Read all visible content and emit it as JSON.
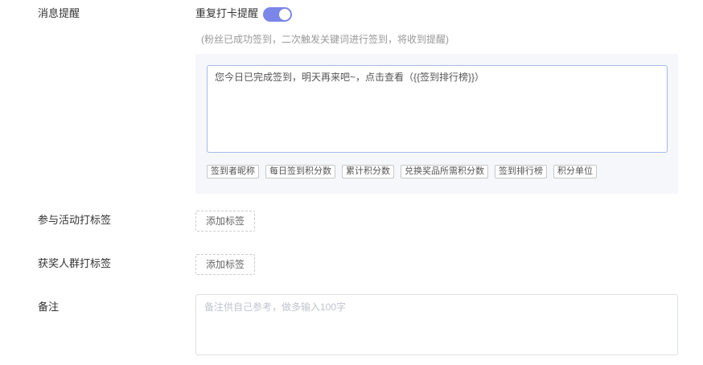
{
  "form": {
    "message_reminder": {
      "label": "消息提醒",
      "repeat_reminder_label": "重复打卡提醒",
      "repeat_reminder_enabled": true,
      "hint": "(粉丝已成功签到，二次触发关键词进行签到，将收到提醒)",
      "message_text": "您今日已完成签到，明天再来吧~，点击查看（{{签到排行榜}}）",
      "variables": [
        "签到者昵称",
        "每日签到积分数",
        "累计积分数",
        "兑换奖品所需积分数",
        "签到排行榜",
        "积分单位"
      ]
    },
    "activity_tag": {
      "label": "参与活动打标签",
      "button_label": "添加标签"
    },
    "winner_tag": {
      "label": "获奖人群打标签",
      "button_label": "添加标签"
    },
    "remark": {
      "label": "备注",
      "value": "",
      "placeholder": "备注供自己参考，做多输入100字"
    }
  },
  "colors": {
    "accent": "#7b86e8",
    "panel_bg": "#f5f7fa",
    "focus_border": "#a8b9ea"
  }
}
